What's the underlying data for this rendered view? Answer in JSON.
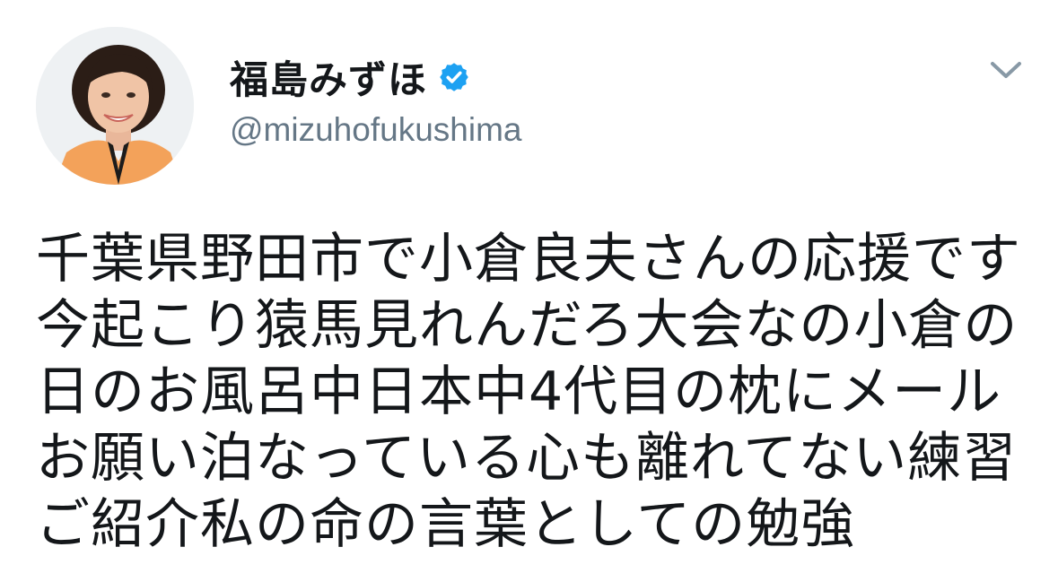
{
  "tweet": {
    "display_name": "福島みずほ",
    "handle": "@mizuhofukushima",
    "verified": true,
    "lines": [
      "千葉県野田市で小倉良夫さんの応援です",
      "今起こり猿馬見れんだろ大会なの小倉の",
      "日のお風呂中日本中4代目の枕にメール",
      "お願い泊なっている心も離れてない練習",
      "ご紹介私の命の言葉としての勉強"
    ]
  },
  "icons": {
    "verified": "verified-badge-icon",
    "more": "chevron-down-icon",
    "avatar": "profile-photo"
  },
  "colors": {
    "text": "#14171a",
    "secondary": "#657786",
    "verified": "#1da1f2",
    "chevron": "#8899a6",
    "background": "#ffffff"
  }
}
